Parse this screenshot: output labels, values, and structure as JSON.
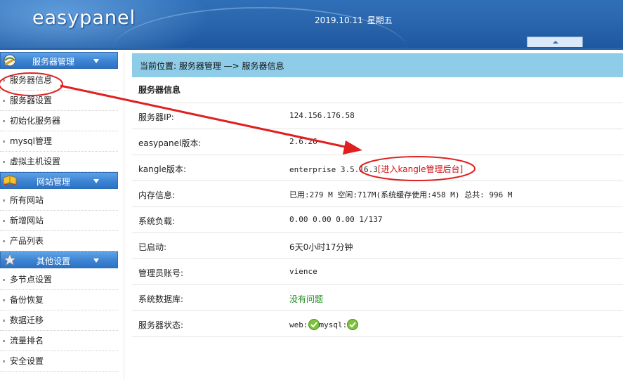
{
  "header": {
    "logo": "easypanel",
    "date": "2019.10.11",
    "weekday": "星期五"
  },
  "sidebar": {
    "sections": [
      {
        "title": "服务器管理",
        "icon": "tools-globe-icon",
        "items": [
          "服务器信息",
          "服务器设置",
          "初始化服务器",
          "mysql管理",
          "虚拟主机设置"
        ]
      },
      {
        "title": "网站管理",
        "icon": "book-icon",
        "items": [
          "所有网站",
          "新增网站",
          "产品列表"
        ]
      },
      {
        "title": "其他设置",
        "icon": "star-icon",
        "items": [
          "多节点设置",
          "备份恢复",
          "数据迁移",
          "流量排名",
          "安全设置"
        ]
      }
    ]
  },
  "breadcrumb": "当前位置: 服务器管理 —> 服务器信息",
  "panel": {
    "title": "服务器信息",
    "rows": [
      {
        "label": "服务器IP:",
        "value": "124.156.176.58"
      },
      {
        "label": "easypanel版本:",
        "value": "2.6.26"
      },
      {
        "label": "kangle版本:",
        "value": "enterprise 3.5.16.3",
        "link": "[进入kangle管理后台]"
      },
      {
        "label": "内存信息:",
        "value": "已用:279 M 空闲:717M(系统缓存使用:458 M) 总共: 996 M"
      },
      {
        "label": "系统负载:",
        "value": "0.00 0.00 0.00 1/137"
      },
      {
        "label": "已启动:",
        "value": "6天0小时17分钟"
      },
      {
        "label": "管理员账号:",
        "value": "vience"
      },
      {
        "label": "系统数据库:",
        "value": "没有问题"
      },
      {
        "label": "服务器状态:",
        "web_label": "web:",
        "mysql_label": "mysql:"
      }
    ]
  },
  "colors": {
    "header_blue": "#2a66ad",
    "breadcrumb_bg": "#8fcce8",
    "annotation_red": "#e02020",
    "ok_green": "#7cc23a"
  }
}
